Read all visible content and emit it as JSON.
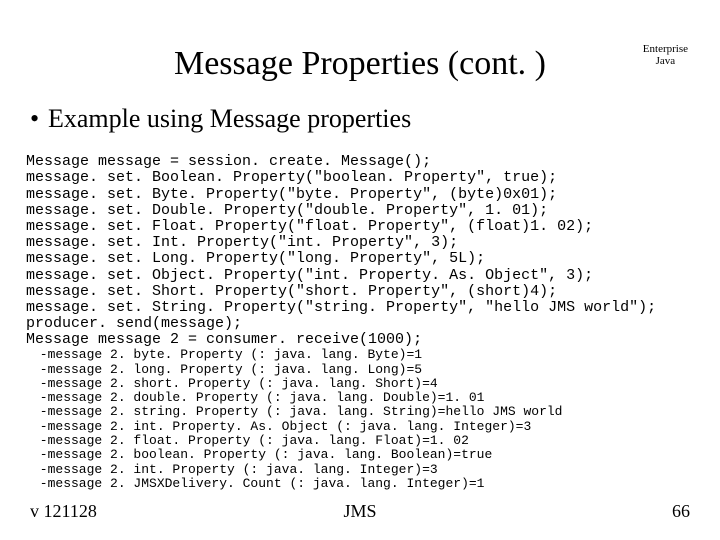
{
  "title": "Message Properties (cont. )",
  "corner_label_line1": "Enterprise",
  "corner_label_line2": "Java",
  "bullet_text": "Example using Message properties",
  "code_lines": [
    "Message message = session. create. Message();",
    "message. set. Boolean. Property(\"boolean. Property\", true);",
    "message. set. Byte. Property(\"byte. Property\", (byte)0x01);",
    "message. set. Double. Property(\"double. Property\", 1. 01);",
    "message. set. Float. Property(\"float. Property\", (float)1. 02);",
    "message. set. Int. Property(\"int. Property\", 3);",
    "message. set. Long. Property(\"long. Property\", 5L);",
    "message. set. Object. Property(\"int. Property. As. Object\", 3);",
    "message. set. Short. Property(\"short. Property\", (short)4);",
    "message. set. String. Property(\"string. Property\", \"hello JMS world\");",
    "producer. send(message);",
    "Message message 2 = consumer. receive(1000);"
  ],
  "output_lines": [
    " -message 2. byte. Property (: java. lang. Byte)=1",
    " -message 2. long. Property (: java. lang. Long)=5",
    " -message 2. short. Property (: java. lang. Short)=4",
    " -message 2. double. Property (: java. lang. Double)=1. 01",
    " -message 2. string. Property (: java. lang. String)=hello JMS world",
    " -message 2. int. Property. As. Object (: java. lang. Integer)=3",
    " -message 2. float. Property (: java. lang. Float)=1. 02",
    " -message 2. boolean. Property (: java. lang. Boolean)=true",
    " -message 2. int. Property (: java. lang. Integer)=3",
    " -message 2. JMSXDelivery. Count (: java. lang. Integer)=1"
  ],
  "footer_left": "v 121128",
  "footer_center": "JMS",
  "footer_right": "66"
}
